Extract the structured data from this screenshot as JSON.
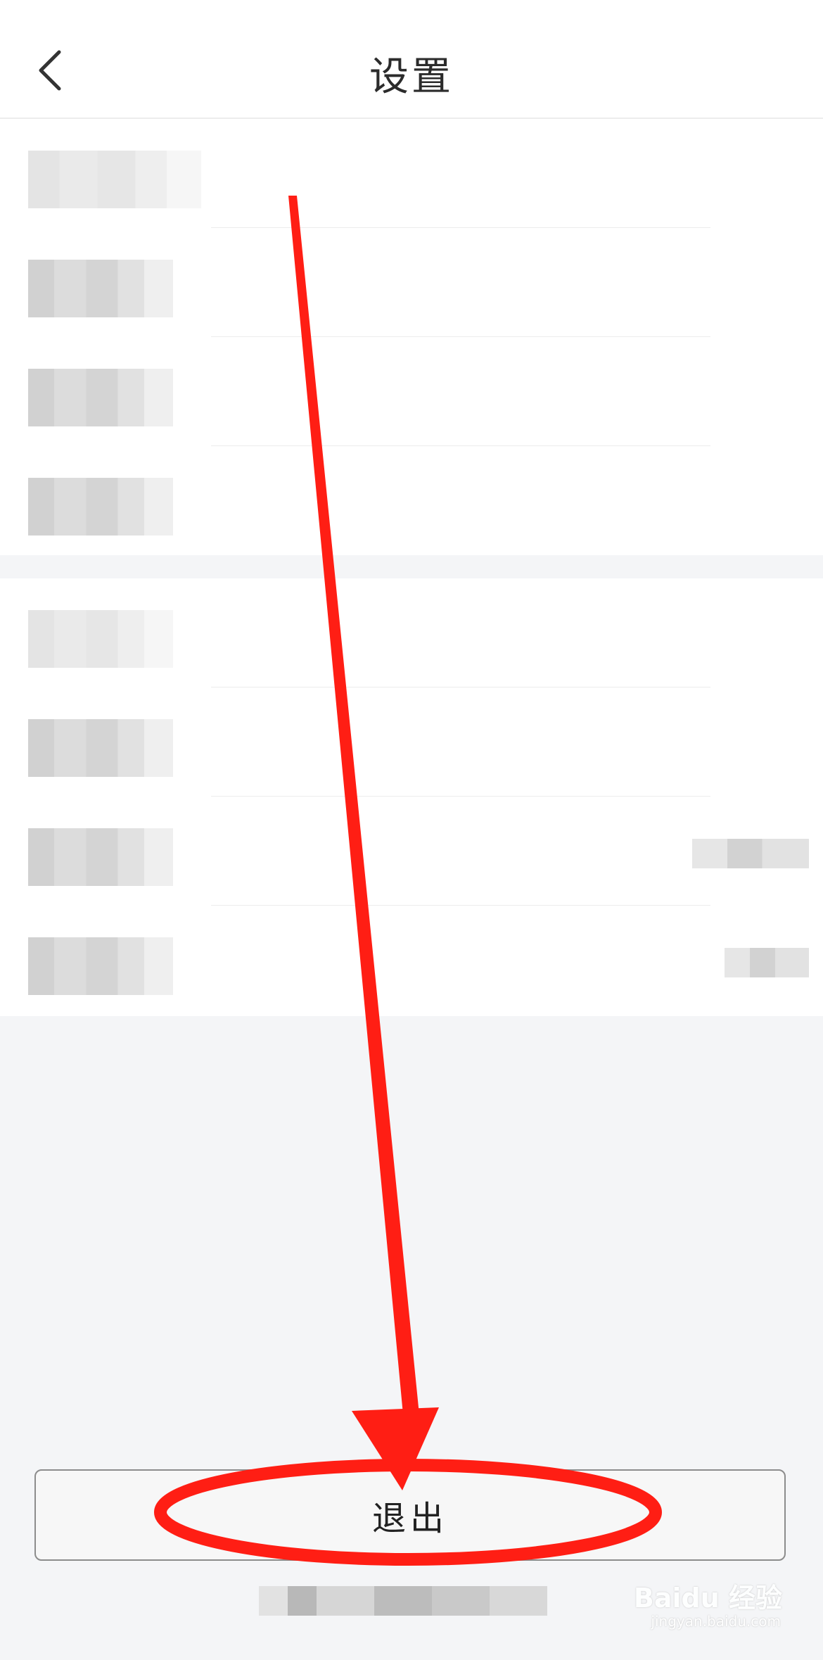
{
  "header": {
    "title": "设置",
    "back_icon": "chevron-left-icon"
  },
  "logout": {
    "label": "退出"
  },
  "watermark": {
    "brand": "Baidu 经验",
    "url": "jingyan.baidu.com"
  },
  "colors": {
    "annotation": "#ff1e14",
    "background": "#f4f5f7"
  }
}
